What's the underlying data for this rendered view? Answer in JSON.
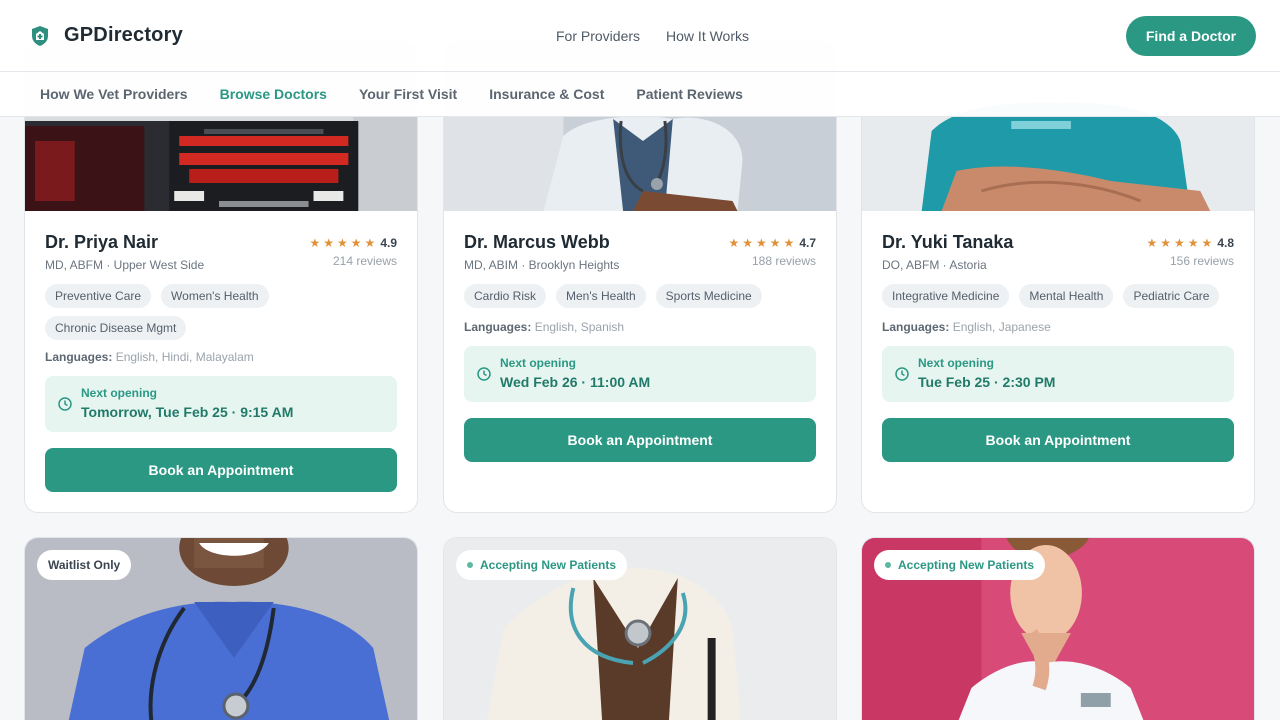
{
  "header": {
    "brand": "GPDirectory",
    "nav": [
      "For Providers",
      "How It Works"
    ],
    "cta": "Find a Doctor"
  },
  "subnav": [
    {
      "label": "How We Vet Providers",
      "active": false
    },
    {
      "label": "Browse Doctors",
      "active": true
    },
    {
      "label": "Your First Visit",
      "active": false
    },
    {
      "label": "Insurance & Cost",
      "active": false
    },
    {
      "label": "Patient Reviews",
      "active": false
    }
  ],
  "doctors": [
    {
      "name": "Dr. Priya Nair",
      "credentials": "MD, ABFM · Upper West Side",
      "stars": "★★★★★",
      "rating": "4.9",
      "reviews": "214 reviews",
      "specialties": [
        "Preventive Care",
        "Women's Health",
        "Chronic Disease Mgmt"
      ],
      "languages_label": "Languages:",
      "languages": "English, Hindi, Malayalam",
      "next_label": "Next opening",
      "next_time": "Tomorrow, Tue Feb 25 · 9:15 AM",
      "book_label": "Book an Appointment"
    },
    {
      "name": "Dr. Marcus Webb",
      "credentials": "MD, ABIM · Brooklyn Heights",
      "stars": "★★★★★",
      "rating": "4.7",
      "reviews": "188 reviews",
      "specialties": [
        "Cardio Risk",
        "Men's Health",
        "Sports Medicine"
      ],
      "languages_label": "Languages:",
      "languages": "English, Spanish",
      "next_label": "Next opening",
      "next_time": "Wed Feb 26 · 11:00 AM",
      "book_label": "Book an Appointment"
    },
    {
      "name": "Dr. Yuki Tanaka",
      "credentials": "DO, ABFM · Astoria",
      "stars": "★★★★★",
      "rating": "4.8",
      "reviews": "156 reviews",
      "specialties": [
        "Integrative Medicine",
        "Mental Health",
        "Pediatric Care"
      ],
      "languages_label": "Languages:",
      "languages": "English, Japanese",
      "next_label": "Next opening",
      "next_time": "Tue Feb 25 · 2:30 PM",
      "book_label": "Book an Appointment"
    }
  ],
  "lower_cards": [
    {
      "badge": "Waitlist Only",
      "status": "waitlist"
    },
    {
      "badge": "Accepting New Patients",
      "status": "accepting"
    },
    {
      "badge": "Accepting New Patients",
      "status": "accepting"
    }
  ],
  "colors": {
    "accent": "#2b9884",
    "accent_light": "#e7f5f1",
    "star": "#e0913a"
  }
}
